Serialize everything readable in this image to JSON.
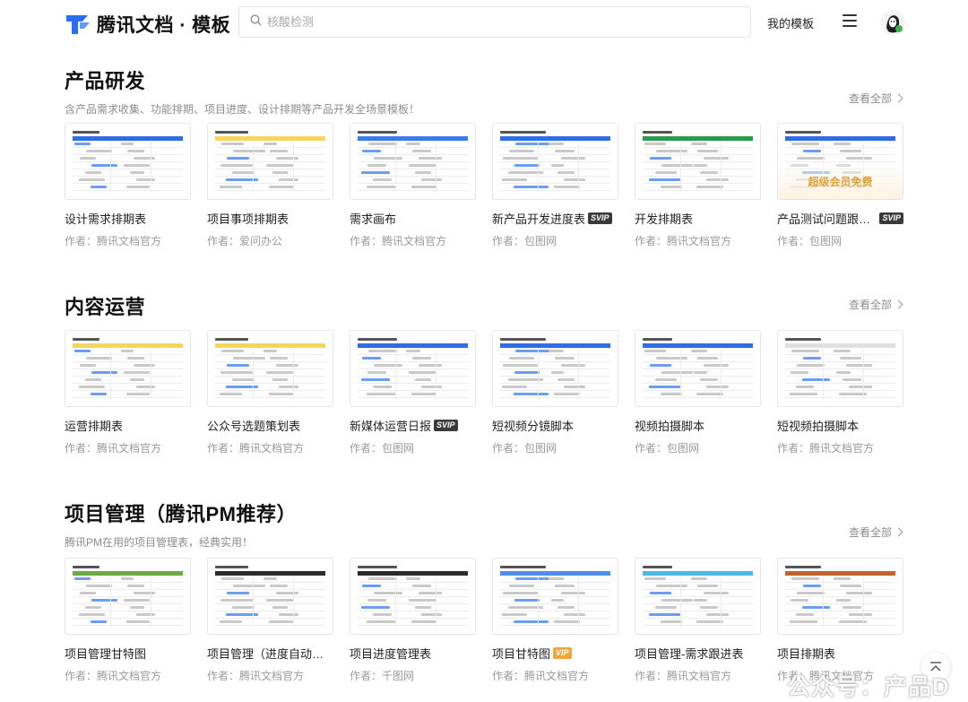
{
  "header": {
    "logo_text": "腾讯文档 · 模板",
    "search_placeholder": "核酸检测",
    "my_templates": "我的模板"
  },
  "author_prefix": "作者：",
  "view_all_label": "查看全部",
  "member_free_label": "超级会员免费",
  "sections": [
    {
      "title": "产品研发",
      "desc": "含产品需求收集、功能排期、项目进度、设计排期等产品开发全场景模板！",
      "cards": [
        {
          "title": "设计需求排期表",
          "author": "腾讯文档官方",
          "badge": "",
          "header_color": "#2f6de6"
        },
        {
          "title": "项目事项排期表",
          "author": "爱问办公",
          "badge": "",
          "header_color": "#f5d65c"
        },
        {
          "title": "需求画布",
          "author": "腾讯文档官方",
          "badge": "",
          "header_color": "#3c7be8"
        },
        {
          "title": "新产品开发进度表",
          "author": "包图网",
          "badge": "SVIP",
          "header_color": "#2f6de6"
        },
        {
          "title": "开发排期表",
          "author": "腾讯文档官方",
          "badge": "",
          "header_color": "#2b9a4a"
        },
        {
          "title": "产品测试问题跟踪记录表",
          "author": "包图网",
          "badge": "SVIP",
          "header_color": "#2f6de6"
        }
      ]
    },
    {
      "title": "内容运营",
      "desc": "",
      "cards": [
        {
          "title": "运营排期表",
          "author": "腾讯文档官方",
          "badge": "",
          "header_color": "#f5d65c"
        },
        {
          "title": "公众号选题策划表",
          "author": "腾讯文档官方",
          "badge": "",
          "header_color": "#f5d65c"
        },
        {
          "title": "新媒体运营日报",
          "author": "包图网",
          "badge": "SVIP",
          "header_color": "#2f6de6"
        },
        {
          "title": "短视频分镜脚本",
          "author": "包图网",
          "badge": "",
          "header_color": "#2f6de6"
        },
        {
          "title": "视频拍摄脚本",
          "author": "包图网",
          "badge": "",
          "header_color": "#2f6de6"
        },
        {
          "title": "短视频拍摄脚本",
          "author": "腾讯文档官方",
          "badge": "",
          "header_color": "#e0e0e0"
        }
      ]
    },
    {
      "title": "项目管理（腾讯PM推荐）",
      "desc": "腾讯PM在用的项目管理表，经典实用！",
      "cards": [
        {
          "title": "项目管理甘特图",
          "author": "腾讯文档官方",
          "badge": "",
          "header_color": "#6dab3c"
        },
        {
          "title": "项目管理（进度自动更新）",
          "author": "腾讯文档官方",
          "badge": "",
          "header_color": "#2b2b2b"
        },
        {
          "title": "项目进度管理表",
          "author": "千图网",
          "badge": "",
          "header_color": "#2b2b2b"
        },
        {
          "title": "项目甘特图",
          "author": "腾讯文档官方",
          "badge": "VIP",
          "header_color": "#4d8ee8"
        },
        {
          "title": "项目管理-需求跟进表",
          "author": "腾讯文档官方",
          "badge": "",
          "header_color": "#4db7e8"
        },
        {
          "title": "项目排期表",
          "author": "腾讯文档官方",
          "badge": "",
          "header_color": "#c0652a"
        }
      ]
    }
  ],
  "watermark": "公众号：产品D"
}
